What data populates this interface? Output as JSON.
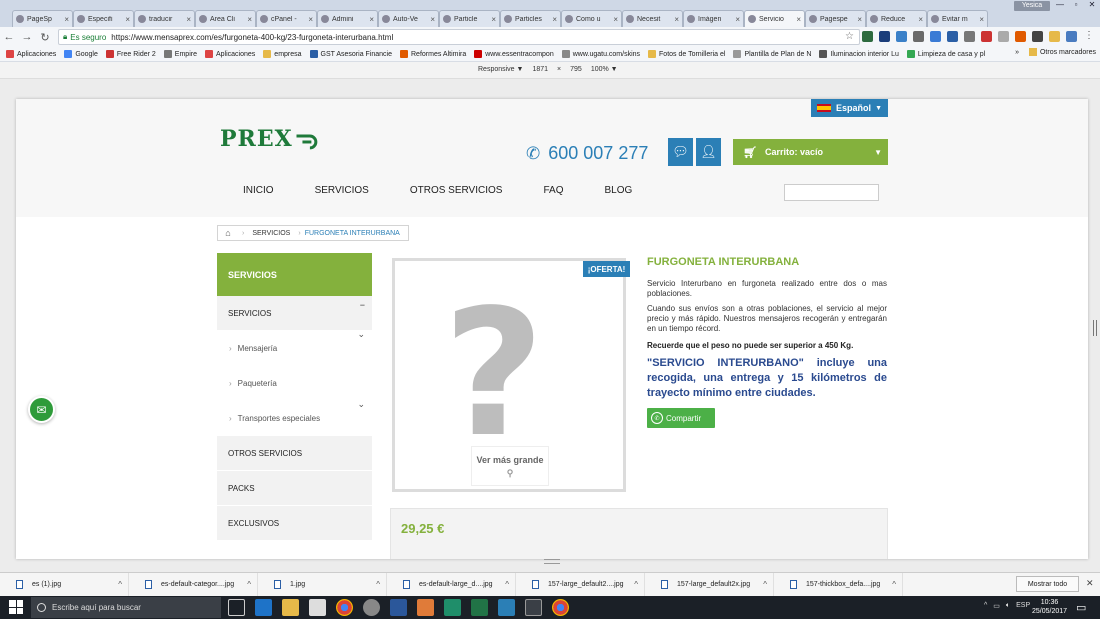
{
  "browser": {
    "tabs": [
      {
        "title": "PageSp",
        "active": false
      },
      {
        "title": "Especifi",
        "active": false
      },
      {
        "title": "traducir",
        "active": false
      },
      {
        "title": "Área Cli",
        "active": false
      },
      {
        "title": "cPanel -",
        "active": false
      },
      {
        "title": "Admini",
        "active": false
      },
      {
        "title": "Auto-Ve",
        "active": false
      },
      {
        "title": "Particle",
        "active": false
      },
      {
        "title": "Particles",
        "active": false
      },
      {
        "title": "Como u",
        "active": false
      },
      {
        "title": "Necesit",
        "active": false
      },
      {
        "title": "Imágen",
        "active": false
      },
      {
        "title": "Servicio",
        "active": true
      },
      {
        "title": "Pagespe",
        "active": false
      },
      {
        "title": "Reduce",
        "active": false
      },
      {
        "title": "Evitar m",
        "active": false
      }
    ],
    "profile_label": "Yesica",
    "address": {
      "secure_label": "Es seguro",
      "url": "https://www.mensaprex.com/es/furgoneta-400-kg/23-furgoneta-interurbana.html"
    },
    "bookmarks": [
      {
        "label": "Aplicaciones",
        "icon": "apps-icon",
        "color": "#d44"
      },
      {
        "label": "Google",
        "icon": "google-icon",
        "color": "#4285f4"
      },
      {
        "label": "Free Rider 2",
        "icon": "bookmark-icon",
        "color": "#c33"
      },
      {
        "label": "Empire",
        "icon": "bookmark-icon",
        "color": "#777"
      },
      {
        "label": "Aplicaciones",
        "icon": "apps-icon",
        "color": "#d44"
      },
      {
        "label": "empresa",
        "icon": "folder-icon",
        "color": "#e6b949"
      },
      {
        "label": "GST Asesoria Financie",
        "icon": "bookmark-icon",
        "color": "#2b5fa6"
      },
      {
        "label": "Reformes Altimira",
        "icon": "bookmark-icon",
        "color": "#e05a00"
      },
      {
        "label": "www.essentracompon",
        "icon": "bookmark-icon",
        "color": "#c00"
      },
      {
        "label": "www.ugatu.com/skins",
        "icon": "bookmark-icon",
        "color": "#888"
      },
      {
        "label": "Fotos de Tornilleria el",
        "icon": "folder-icon",
        "color": "#e6b949"
      },
      {
        "label": "Plantilla de Plan de N",
        "icon": "page-icon",
        "color": "#999"
      },
      {
        "label": "Iluminacion interior Lu",
        "icon": "wordpress-icon",
        "color": "#555"
      },
      {
        "label": "Limpieza de casa y pl",
        "icon": "google-icon",
        "color": "#34a853"
      }
    ],
    "other_bookmarks": "Otros marcadores",
    "devtools": {
      "mode": "Responsive",
      "width": "1871",
      "times": "×",
      "height": "795",
      "zoom": "100%"
    }
  },
  "site": {
    "language": "Español",
    "logo_text": "PREX",
    "phone": "600 007 277",
    "cart_label": "Carrito: vacío",
    "nav": [
      "INICIO",
      "SERVICIOS",
      "OTROS SERVICIOS",
      "FAQ",
      "BLOG"
    ],
    "breadcrumb": {
      "home_icon": "home-icon",
      "items": [
        "SERVICIOS"
      ],
      "current": "FURGONETA INTERURBANA"
    },
    "sidebar": {
      "title": "SERVICIOS",
      "section": "SERVICIOS",
      "toggle": "−",
      "subitems": [
        "Mensajería",
        "Paquetería",
        "Transportes especiales"
      ],
      "items": [
        "OTROS SERVICIOS",
        "PACKS",
        "EXCLUSIVOS"
      ]
    },
    "product": {
      "badge": "¡OFERTA!",
      "zoom_label": "Ver más grande",
      "name": "FURGONETA INTERURBANA",
      "desc1": "Servicio Interurbano en furgoneta realizado entre dos o mas poblaciones.",
      "desc2": "Cuando sus envíos son a otras poblaciones, el servicio al mejor precio y más rápido. Nuestros mensajeros recogerán y entregarán en un tiempo récord.",
      "weight_note": "Recuerde que el peso no puede ser superior a 450 Kg.",
      "highlight": "\"SERVICIO INTERURBANO\" incluye una recogida, una entrega y 15 kilómetros de trayecto mínimo entre ciudades.",
      "share_label": "Compartir",
      "price": "29,25 €"
    },
    "colors": {
      "green": "#84b13d",
      "blue": "#2b7fb6",
      "navy": "#2a4a8f"
    }
  },
  "downloads": {
    "files": [
      "es (1).jpg",
      "es-default-categor....jpg",
      "1.jpg",
      "es-default-large_d....jpg",
      "157-large_default2....jpg",
      "157-large_default2x.jpg",
      "157-thickbox_defa....jpg"
    ],
    "show_all": "Mostrar todo"
  },
  "taskbar": {
    "search_placeholder": "Escribe aquí para buscar",
    "language": "ESP",
    "time": "10:36",
    "date": "25/05/2017"
  }
}
